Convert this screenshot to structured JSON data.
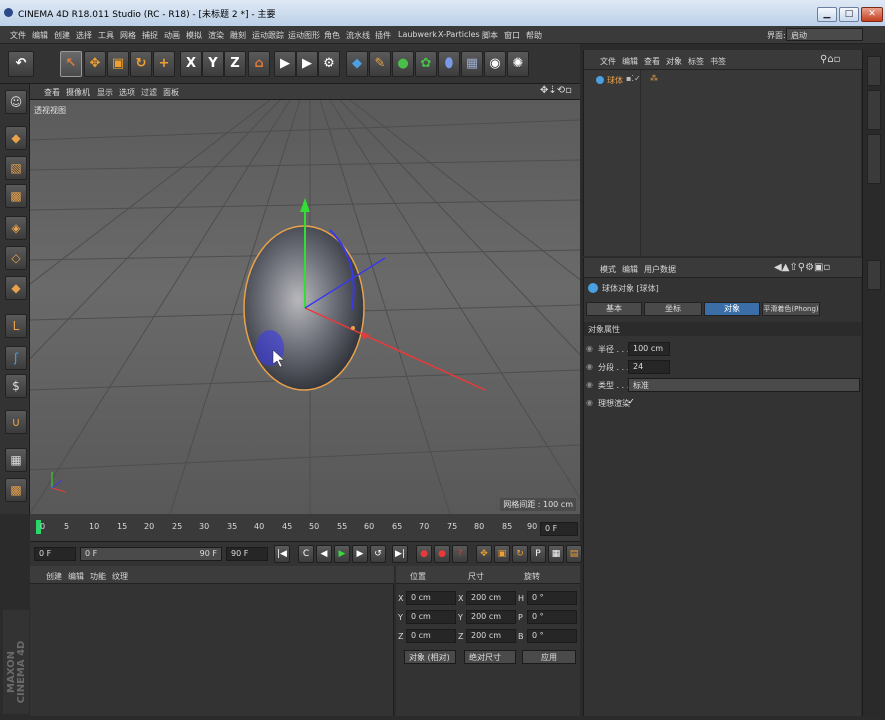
{
  "window": {
    "title": "CINEMA 4D R18.011 Studio (RC - R18) - [未标题 2 *] - 主要",
    "min_label": "▁",
    "max_label": "□",
    "close_label": "✕"
  },
  "menubar": {
    "items": [
      "文件",
      "编辑",
      "创建",
      "选择",
      "工具",
      "网格",
      "捕捉",
      "动画",
      "模拟",
      "渲染",
      "雕刻",
      "运动跟踪",
      "运动图形",
      "角色",
      "流水线",
      "插件",
      "Laubwerk",
      "X-Particles",
      "脚本",
      "窗口",
      "帮助"
    ],
    "layout_label": "界面:",
    "layout_value": "启动"
  },
  "toolbar": {
    "axis_x": "X",
    "axis_y": "Y",
    "axis_z": "Z"
  },
  "viewport": {
    "menu": [
      "查看",
      "摄像机",
      "显示",
      "选项",
      "过滤",
      "面板"
    ],
    "label": "透视视图",
    "grid_spacing": "网格间距 : 100 cm"
  },
  "timeline": {
    "ticks": [
      "0",
      "5",
      "10",
      "15",
      "20",
      "25",
      "30",
      "35",
      "40",
      "45",
      "50",
      "55",
      "60",
      "65",
      "70",
      "75",
      "80",
      "85",
      "90"
    ],
    "frame_field": "0 F"
  },
  "playback": {
    "start": "0 F",
    "slider_start": "0 F",
    "slider_end": "90 F",
    "end": "90 F"
  },
  "material": {
    "menu": [
      "创建",
      "编辑",
      "功能",
      "纹理"
    ]
  },
  "coords": {
    "headers": [
      "位置",
      "尺寸",
      "旋转"
    ],
    "rows": [
      {
        "a": "X",
        "pos": "0 cm",
        "b": "X",
        "size": "200 cm",
        "c": "H",
        "rot": "0 °"
      },
      {
        "a": "Y",
        "pos": "0 cm",
        "b": "Y",
        "size": "200 cm",
        "c": "P",
        "rot": "0 °"
      },
      {
        "a": "Z",
        "pos": "0 cm",
        "b": "Z",
        "size": "200 cm",
        "c": "B",
        "rot": "0 °"
      }
    ],
    "mode_select": "对象 (相对)",
    "size_select": "绝对尺寸",
    "apply": "应用"
  },
  "brand": {
    "line1": "MAXON",
    "line2": "CINEMA 4D"
  },
  "object_manager": {
    "menu": [
      "文件",
      "编辑",
      "查看",
      "对象",
      "标签",
      "书签"
    ],
    "object_name": "球体"
  },
  "attribute_manager": {
    "menu": [
      "模式",
      "编辑",
      "用户数据"
    ],
    "object_title": "球体对象 [球体]",
    "tabs": [
      "基本",
      "坐标",
      "对象",
      "平滑着色(Phong)"
    ],
    "section": "对象属性",
    "props": [
      {
        "label": "半径 . . . .",
        "value": "100 cm"
      },
      {
        "label": "分段 . . . .",
        "value": "24"
      },
      {
        "label": "类型 . . . .",
        "value": "标准"
      },
      {
        "label": "理想渲染",
        "value": "✓"
      }
    ]
  },
  "colors": {
    "accent": "#3b6ea6",
    "selection": "#e8a24a"
  }
}
